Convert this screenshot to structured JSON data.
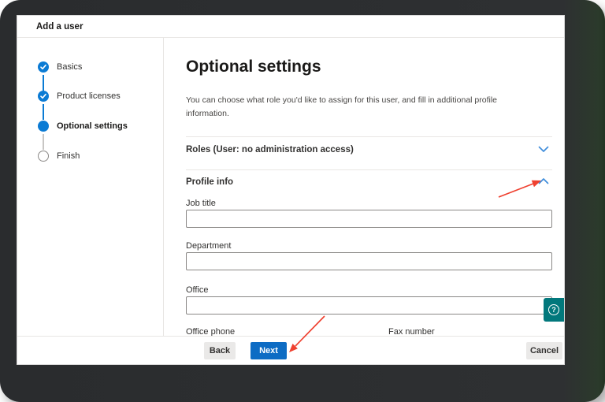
{
  "window": {
    "title": "Add a user"
  },
  "wizard": {
    "steps": [
      {
        "label": "Basics",
        "state": "complete"
      },
      {
        "label": "Product licenses",
        "state": "complete"
      },
      {
        "label": "Optional settings",
        "state": "current"
      },
      {
        "label": "Finish",
        "state": "upcoming"
      }
    ]
  },
  "main": {
    "heading": "Optional settings",
    "description": "You can choose what role you'd like to assign for this user, and fill in additional profile information.",
    "sections": [
      {
        "label": "Roles (User: no administration access)",
        "state": "collapsed"
      },
      {
        "label": "Profile info",
        "state": "expanded"
      }
    ],
    "form": {
      "fields": [
        {
          "label": "Job title",
          "value": ""
        },
        {
          "label": "Department",
          "value": ""
        },
        {
          "label": "Office",
          "value": ""
        }
      ],
      "partial_row": {
        "left_label": "Office phone",
        "right_label": "Fax number"
      }
    }
  },
  "footer": {
    "back_label": "Back",
    "next_label": "Next",
    "cancel_label": "Cancel"
  },
  "help": {
    "glyph": "?"
  },
  "colors": {
    "accent_blue": "#0b7bd4",
    "chevron_blue": "#3f8ddb",
    "next_button_blue": "#0d6cc4",
    "help_teal": "#02787c",
    "arrow_red": "#ef4130",
    "frame_dark": "#2c2e30"
  }
}
